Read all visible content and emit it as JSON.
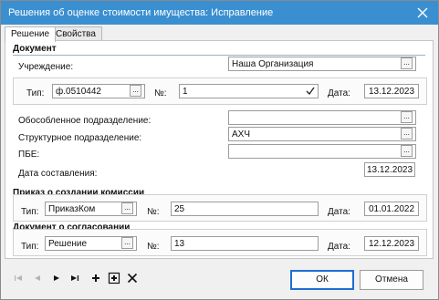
{
  "window": {
    "title": "Решения об оценке стоимости имущества: Исправление"
  },
  "tabs": [
    {
      "label": "Решение"
    },
    {
      "label": "Свойства"
    }
  ],
  "document": {
    "section_title": "Документ",
    "institution_label": "Учреждение:",
    "institution_value": "Наша Организация",
    "type_label": "Тип:",
    "type_value": "ф.0510442",
    "number_label": "№:",
    "number_value": "1",
    "date_label": "Дата:",
    "date_value": "13.12.2023",
    "separate_division_label": "Обособленное подразделение:",
    "separate_division_value": "",
    "structural_division_label": "Структурное подразделение:",
    "structural_division_value": "АХЧ",
    "pbe_label": "ПБЕ:",
    "pbe_value": "",
    "compiled_date_label": "Дата составления:",
    "compiled_date_value": "13.12.2023"
  },
  "commission_order": {
    "section_title": "Приказ о создании комиссии",
    "type_label": "Тип:",
    "type_value": "ПриказКом",
    "number_label": "№:",
    "number_value": "25",
    "date_label": "Дата:",
    "date_value": "01.01.2022"
  },
  "approval_document": {
    "section_title": "Документ о согласовании",
    "type_label": "Тип:",
    "type_value": "Решение",
    "number_label": "№:",
    "number_value": "13",
    "date_label": "Дата:",
    "date_value": "12.12.2023"
  },
  "buttons": {
    "select_glyph": "...",
    "ok_label": "ОК",
    "cancel_label": "Отмена"
  },
  "icons": {
    "close": "close-icon",
    "checkmark": "checkmark-icon",
    "nav": [
      "first-record-icon",
      "previous-record-icon",
      "next-record-icon",
      "last-record-icon",
      "add-record-icon",
      "add-copy-icon",
      "delete-record-icon"
    ]
  },
  "colors": {
    "titlebar": "#3a8fd0",
    "ok_border": "#1d6fd1",
    "section_line": "#9ab0c8"
  }
}
